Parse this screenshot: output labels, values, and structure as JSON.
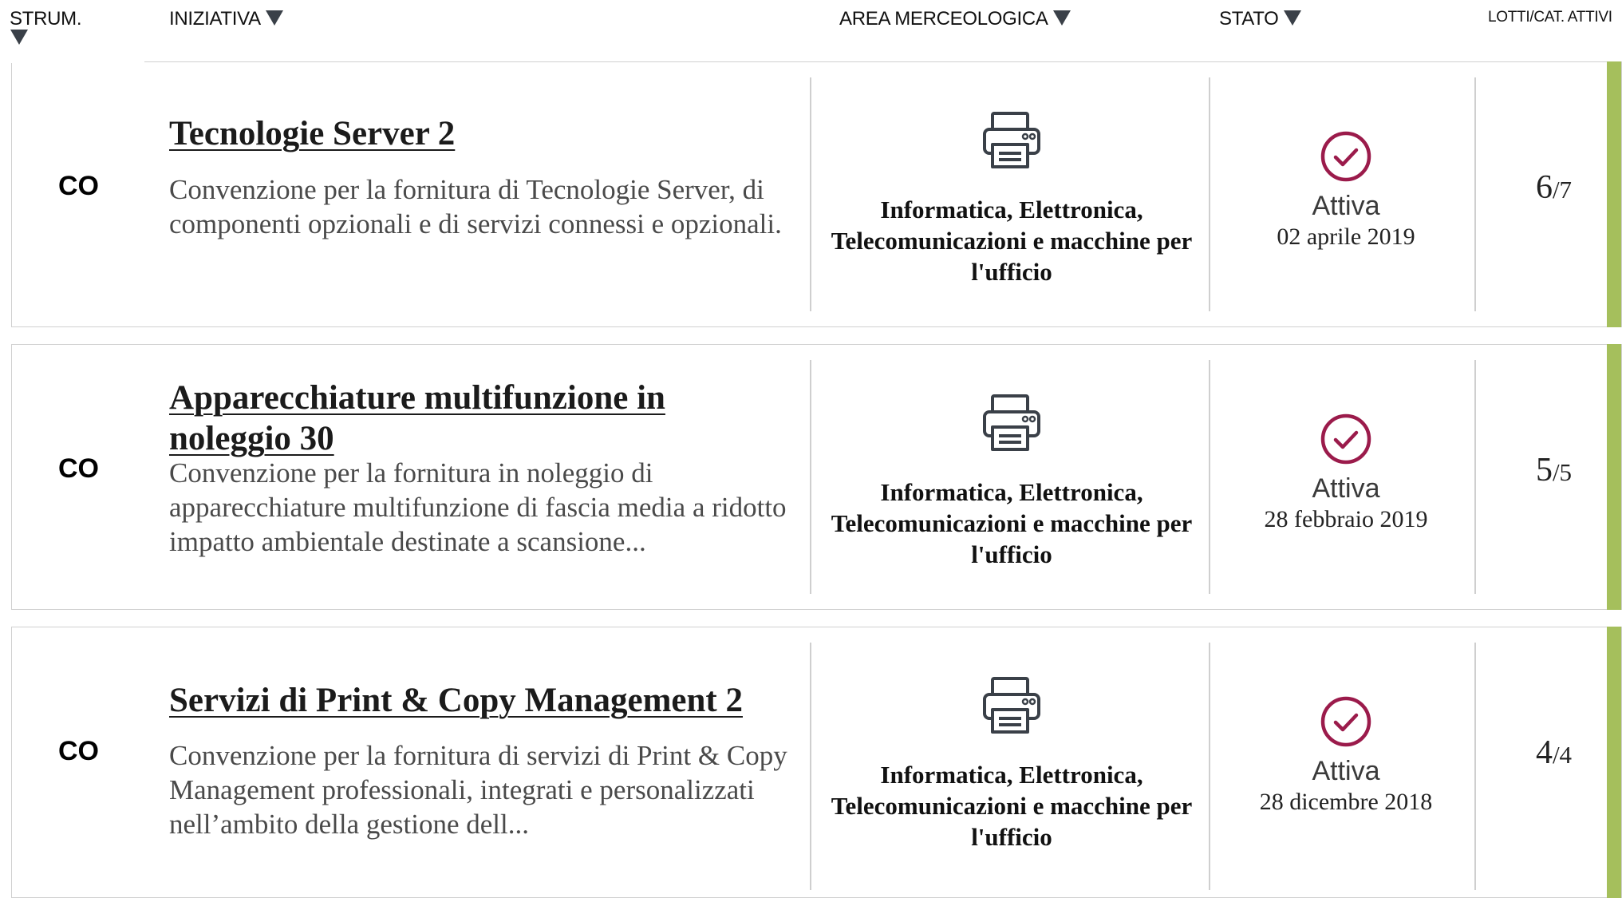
{
  "header": {
    "strum_label": "STRUM.",
    "iniziativa_label": "INIZIATIVA",
    "area_label": "AREA MERCEOLOGICA",
    "stato_label": "STATO",
    "lotti_label": "LOTTI/CAT. ATTIVI",
    "sort_icon": "caret-down-icon"
  },
  "colors": {
    "accent_bar": "#a5bf5c",
    "status_check": "#9b1b4b",
    "printer_icon": "#3a4048"
  },
  "rows": [
    {
      "strumento": "CO",
      "title": "Tecnologie Server 2",
      "description": "Convenzione per la fornitura di Tecnologie Server, di componenti opzionali e di servizi connessi e opzionali.",
      "area_icon": "printer-icon",
      "area": "Informatica, Elettronica, Telecomunicazioni e macchine per l'ufficio",
      "status_icon": "check-circle-icon",
      "status": "Attiva",
      "date": "02 aprile 2019",
      "lotti_active": "6",
      "lotti_total": "/7"
    },
    {
      "strumento": "CO",
      "title": "Apparecchiature multifunzione in noleggio 30",
      "description": "Convenzione per la fornitura in noleggio di apparecchiature multifunzione di fascia media a ridotto impatto ambientale destinate a scansione...",
      "area_icon": "printer-icon",
      "area": "Informatica, Elettronica, Telecomunicazioni e macchine per l'ufficio",
      "status_icon": "check-circle-icon",
      "status": "Attiva",
      "date": "28 febbraio 2019",
      "lotti_active": "5",
      "lotti_total": "/5"
    },
    {
      "strumento": "CO",
      "title": "Servizi di Print & Copy Management 2",
      "description": "Convenzione per la fornitura di servizi di Print & Copy Management professionali, integrati e personalizzati nell’ambito della gestione dell...",
      "area_icon": "printer-icon",
      "area": "Informatica, Elettronica, Telecomunicazioni e macchine per l'ufficio",
      "status_icon": "check-circle-icon",
      "status": "Attiva",
      "date": "28 dicembre 2018",
      "lotti_active": "4",
      "lotti_total": "/4"
    }
  ]
}
